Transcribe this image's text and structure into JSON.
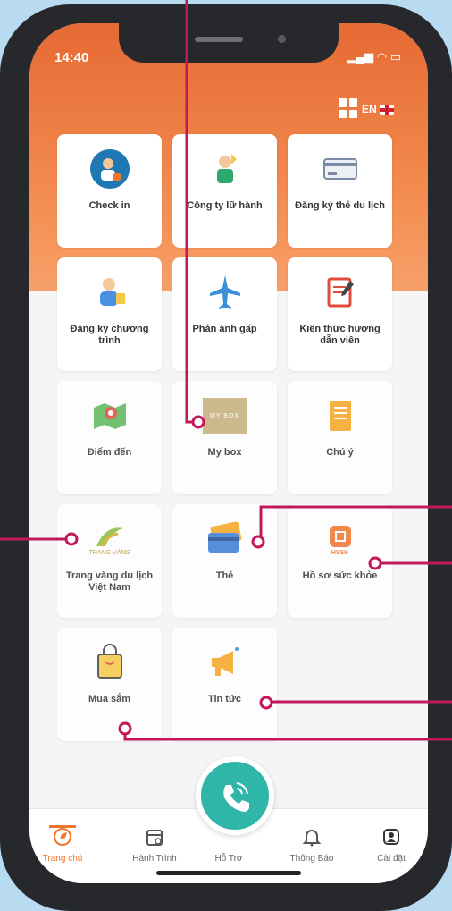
{
  "status": {
    "time": "14:40"
  },
  "header": {
    "lang": "EN"
  },
  "tiles": [
    {
      "label": "Check in",
      "icon": "check-in-icon"
    },
    {
      "label": "Công ty lữ hành",
      "icon": "travel-company-icon"
    },
    {
      "label": "Đăng ký thẻ du lịch",
      "icon": "travel-card-icon"
    },
    {
      "label": "Đăng ký chương trình",
      "icon": "register-program-icon"
    },
    {
      "label": "Phản ánh gấp",
      "icon": "airplane-icon"
    },
    {
      "label": "Kiến thức hướng dẫn viên",
      "icon": "guide-knowledge-icon"
    },
    {
      "label": "Điểm đến",
      "icon": "destination-map-icon"
    },
    {
      "label": "My box",
      "icon": "my-box-icon"
    },
    {
      "label": "Chú ý",
      "icon": "notice-document-icon"
    },
    {
      "label": "Trang vàng du lịch Việt Nam",
      "icon": "yellow-pages-icon"
    },
    {
      "label": "Thẻ",
      "icon": "cards-icon"
    },
    {
      "label": "Hồ sơ sức khỏe",
      "icon": "health-record-icon"
    },
    {
      "label": "Mua sắm",
      "icon": "shopping-bag-icon"
    },
    {
      "label": "Tin tức",
      "icon": "megaphone-icon"
    }
  ],
  "mybox_text": "MY BOX",
  "health_text": "HSSK",
  "yellow_text": "TRANG VÀNG",
  "tabs": [
    {
      "label": "Trang chủ",
      "icon": "compass-icon"
    },
    {
      "label": "Hành Trình",
      "icon": "itinerary-calendar-icon"
    },
    {
      "label": "Hỗ Trợ",
      "icon": "support-call-icon"
    },
    {
      "label": "Thông Báo",
      "icon": "bell-icon"
    },
    {
      "label": "Cài đặt",
      "icon": "settings-person-icon"
    }
  ],
  "colors": {
    "accent": "#f0762f",
    "call": "#2fb6a8",
    "annotation": "#c2185b"
  }
}
